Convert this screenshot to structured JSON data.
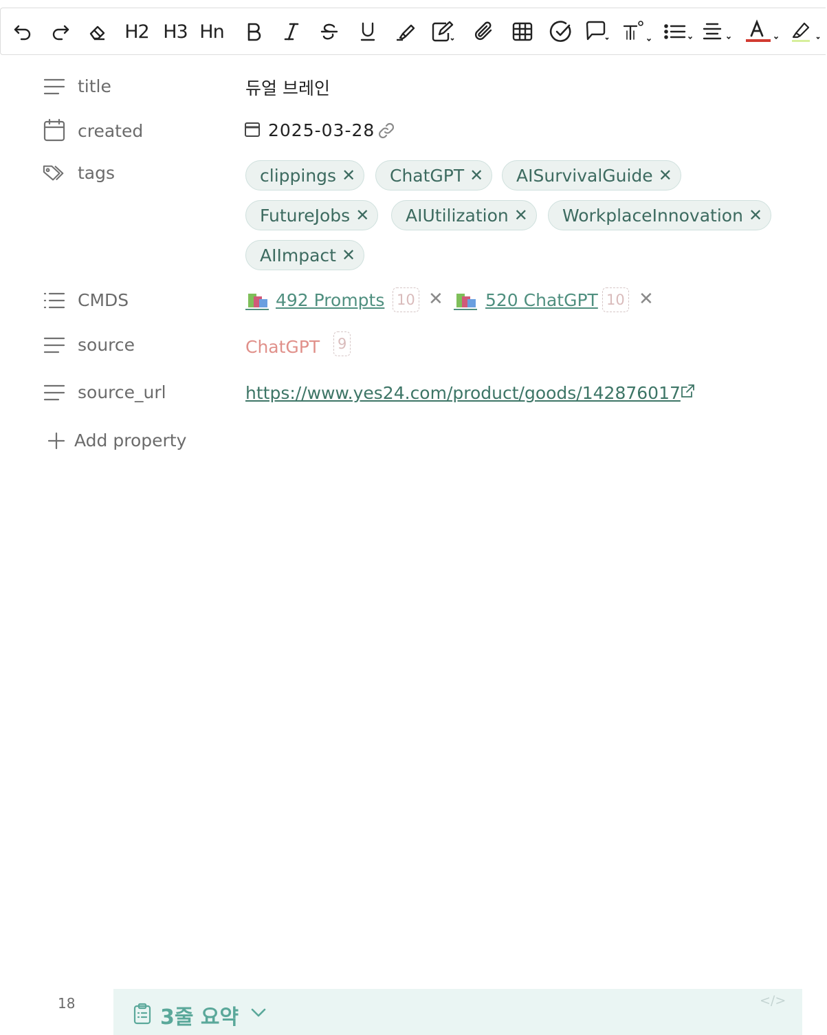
{
  "toolbar": {
    "h2": "H2",
    "h3": "H3",
    "hn": "Hn",
    "text_color": "#d23b32",
    "highlight_color": "#d7ef9c"
  },
  "properties": {
    "title": {
      "label": "title",
      "value": "듀얼 브레인"
    },
    "created": {
      "label": "created",
      "value": "2025-03-28"
    },
    "tags": {
      "label": "tags",
      "items": [
        "clippings",
        "ChatGPT",
        "AISurvivalGuide",
        "FutureJobs",
        "AIUtilization",
        "WorkplaceInnovation",
        "AIImpact"
      ]
    },
    "cmds": {
      "label": "CMDS",
      "items": [
        {
          "text": "492 Prompts",
          "count": "10"
        },
        {
          "text": "520 ChatGPT",
          "count": "10"
        }
      ]
    },
    "source": {
      "label": "source",
      "value": "ChatGPT",
      "count": "9"
    },
    "source_url": {
      "label": "source_url",
      "value": "https://www.yes24.com/product/goods/142876017"
    },
    "add_property": "Add property"
  },
  "editor": {
    "line_number": "18",
    "callout_title": "3줄 요약",
    "code_toggle": "</>"
  },
  "colors": {
    "accent": "#4f8f7f",
    "tag_bg": "#ecf2f0",
    "source_text": "#e0908a",
    "callout_bg": "#eaf5f3"
  }
}
